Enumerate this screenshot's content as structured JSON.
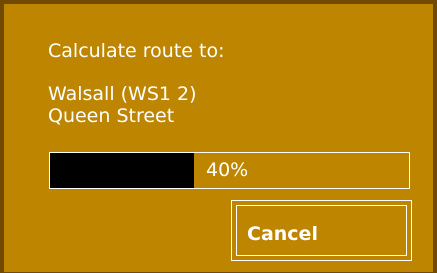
{
  "dialog": {
    "heading": "Calculate route to:",
    "destination_line1": "Walsall (WS1 2)",
    "destination_line2": "Queen Street",
    "progress": {
      "value": 40,
      "label": "40%"
    },
    "cancel_label": "Cancel"
  },
  "colors": {
    "background": "#bd8500",
    "border": "#6f4a00",
    "text": "#ffffff",
    "progress_fill": "#000000"
  }
}
